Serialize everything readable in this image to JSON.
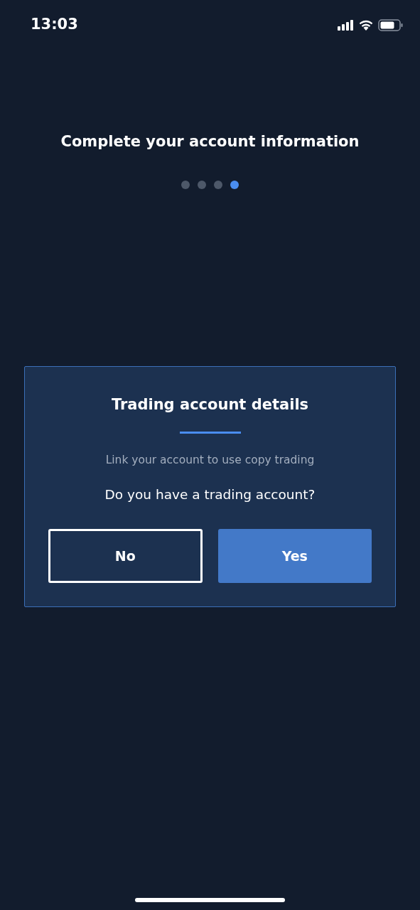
{
  "status_bar": {
    "time": "13:03"
  },
  "header": {
    "title": "Complete your account information"
  },
  "steps": [
    {
      "selected": false
    },
    {
      "selected": false
    },
    {
      "selected": false
    },
    {
      "selected": true
    }
  ],
  "card": {
    "title": "Trading account details",
    "subtitle": "Link your account to use copy trading",
    "question": "Do you have a trading account?",
    "buttons": [
      {
        "label": "No",
        "kind": "outline"
      },
      {
        "label": "Yes",
        "kind": "primary"
      }
    ]
  }
}
